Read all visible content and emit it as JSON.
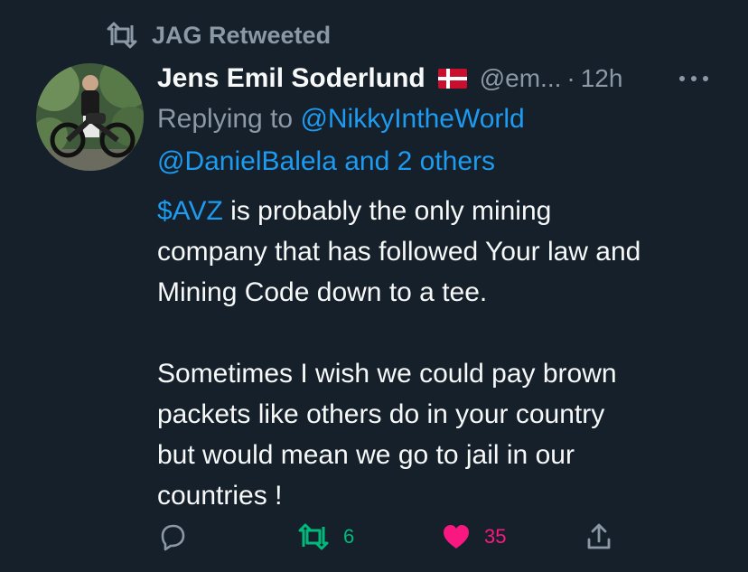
{
  "retweet": {
    "icon": "retweet-icon",
    "label": "JAG Retweeted"
  },
  "author": {
    "name": "Jens Emil Soderlund",
    "flag": "denmark-flag-icon",
    "handle": "@em...",
    "separator": "·",
    "time": "12h"
  },
  "replying": {
    "prefix": "Replying to ",
    "user1": "@NikkyIntheWorld",
    "user2": "@DanielBalela and 2 others"
  },
  "tweet": {
    "cashtag": "$AVZ",
    "line1_rest": " is probably the only mining",
    "line2": "company that has followed Your law and",
    "line3": "Mining Code down to a tee.",
    "line4": "Sometimes I wish we could pay brown",
    "line5": "packets like others do in your country",
    "line6": "but would mean we go to jail in our",
    "line7": "countries !"
  },
  "actions": {
    "reply_icon": "reply-icon",
    "retweet_icon": "retweet-icon",
    "retweet_count": "6",
    "like_icon": "heart-icon",
    "like_count": "35",
    "share_icon": "share-icon"
  },
  "colors": {
    "background": "#15202b",
    "text": "#f7f9f9",
    "secondary": "#8b98a5",
    "link": "#1d9bf0",
    "retweet": "#00ba7c",
    "like": "#f91880"
  }
}
